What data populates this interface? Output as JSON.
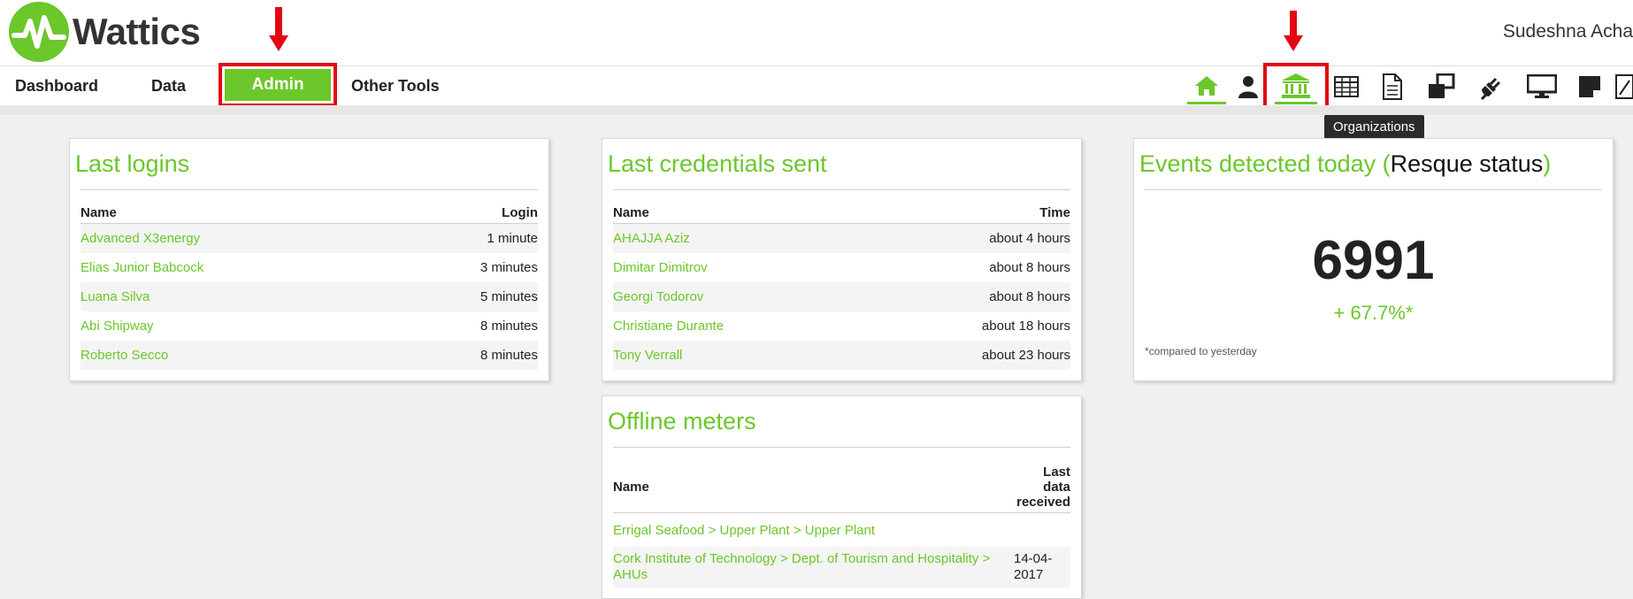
{
  "app": {
    "name": "Wattics",
    "user": "Sudeshna Acha"
  },
  "nav": {
    "dashboard": "Dashboard",
    "data": "Data",
    "admin": "Admin",
    "other_tools": "Other Tools"
  },
  "toolbar": {
    "icons": [
      "home-icon",
      "user-icon",
      "organizations-icon",
      "table-icon",
      "document-icon",
      "windows-icon",
      "plug-icon",
      "monitor-icon",
      "sticky-note-icon",
      "edit-icon"
    ],
    "tooltip": "Organizations"
  },
  "colors": {
    "brand": "#6bc72a",
    "highlight": "#e30613"
  },
  "last_logins": {
    "title": "Last logins",
    "col_name": "Name",
    "col_login": "Login",
    "rows": [
      {
        "name": "Advanced X3energy",
        "login": "1 minute"
      },
      {
        "name": "Elias Junior Babcock",
        "login": "3 minutes"
      },
      {
        "name": "Luana Silva",
        "login": "5 minutes"
      },
      {
        "name": "Abi Shipway",
        "login": "8 minutes"
      },
      {
        "name": "Roberto Secco",
        "login": "8 minutes"
      }
    ]
  },
  "last_credentials": {
    "title": "Last credentials sent",
    "col_name": "Name",
    "col_time": "Time",
    "rows": [
      {
        "name": "AHAJJA Aziz",
        "time": "about 4 hours"
      },
      {
        "name": "Dimitar Dimitrov",
        "time": "about 8 hours"
      },
      {
        "name": "Georgi Todorov",
        "time": "about 8 hours"
      },
      {
        "name": "Christiane Durante",
        "time": "about 18 hours"
      },
      {
        "name": "Tony Verrall",
        "time": "about 23 hours"
      }
    ]
  },
  "events": {
    "title_prefix": "Events detected today (",
    "title_status": "Resque status",
    "title_suffix": ")",
    "count": "6991",
    "change": "+ 67.7%*",
    "note": "*compared to yesterday"
  },
  "offline_meters": {
    "title": "Offline meters",
    "col_name": "Name",
    "col_last_1": "Last",
    "col_last_2": "data",
    "col_last_3": "received",
    "rows": [
      {
        "name": "Errigal Seafood > Upper Plant > Upper Plant",
        "date": ""
      },
      {
        "name": "Cork Institute of Technology > Dept. of Tourism and Hospitality > AHUs",
        "date": "14-04-2017"
      }
    ]
  }
}
